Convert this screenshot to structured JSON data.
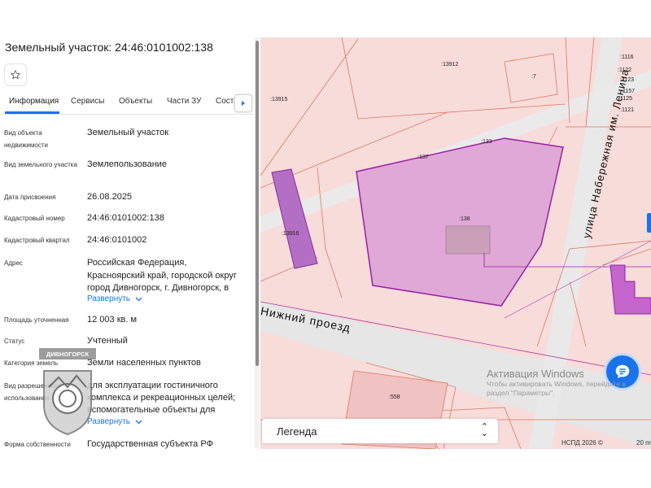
{
  "panel": {
    "title": "Земельный участок: 24:46:0101002:138",
    "tabs": [
      {
        "label": "Информация",
        "active": true
      },
      {
        "label": "Сервисы"
      },
      {
        "label": "Объекты"
      },
      {
        "label": "Части ЗУ"
      },
      {
        "label": "Соста"
      }
    ],
    "fields": [
      {
        "label": "Вид объекта недвижимости",
        "value": "Земельный участок"
      },
      {
        "label": "Вид земельного участка",
        "value": "Землепользование"
      },
      {
        "label": "Дата присвоения",
        "value": "26.08.2025"
      },
      {
        "label": "Кадастровый номер",
        "value": "24:46:0101002:138"
      },
      {
        "label": "Кадастровый квартал",
        "value": "24:46:0101002"
      },
      {
        "label": "Адрес",
        "value_lines": [
          "Российская Федерация,",
          "Красноярский край, городской округ",
          "город Дивногорск, г. Дивногорск, в"
        ]
      },
      {
        "label": "Площадь уточненная",
        "value": "12 003 кв. м"
      },
      {
        "label": "Статус",
        "value": "Учтенный"
      },
      {
        "label": "Категория земель",
        "value": "Земли населенных пунктов"
      },
      {
        "label": "Вид разрешенного использования",
        "value_lines": [
          "для эксплуатации гостиничного",
          "комплекса и рекреационных целей;",
          "вспомогательные объекты для"
        ]
      },
      {
        "label": "Форма собственности",
        "value": "Государственная субъекта РФ"
      }
    ],
    "expand_label": "Развернуть",
    "logo_text": "ДИВНОГОРСК"
  },
  "map": {
    "parcel_labels": {
      "p13912": ":13912",
      "p7": ":7",
      "p13915": ":13915",
      "p1116": ":1116",
      "p1122": ":1122",
      "p1123": ":1123",
      "p1157": ":1157",
      "p1125": ":1125",
      "p1121": ":1121",
      "p137": ":137",
      "p133": ":133",
      "p138": ":138",
      "p13916": ":13916",
      "p558": ":558"
    },
    "streets": {
      "nizhny": "Нижний проезд",
      "lenina": "улица Набережная им. Ленина"
    },
    "legend_label": "Легенда",
    "attribution": "НСПД 2026 ©",
    "scale_label": "20 m",
    "selected_fill": "#e0a8d6",
    "selected_stroke": "#9a1fa5",
    "parcel_stroke": "#e0785a",
    "base_fill": "#f7dcda"
  },
  "watermark": {
    "title": "Активация Windows",
    "line1": "Чтобы активировать Windows, перейдите в",
    "line2": "раздел \"Параметры\"."
  }
}
